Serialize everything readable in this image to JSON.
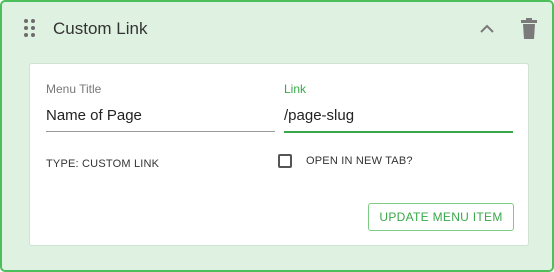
{
  "colors": {
    "accent": "#3aa84a",
    "panel_background": "#dff2e1",
    "panel_border": "#4cbf5a"
  },
  "header": {
    "title": "Custom Link",
    "drag_icon": "drag-handle-icon",
    "collapse_icon": "chevron-up-icon",
    "delete_icon": "trash-icon"
  },
  "form": {
    "menu_title": {
      "label": "Menu Title",
      "value": "Name of Page"
    },
    "link": {
      "label": "Link",
      "value": "/page-slug"
    },
    "type_label": "TYPE: CUSTOM LINK",
    "new_tab": {
      "label": "OPEN IN NEW TAB?",
      "checked": false
    },
    "update_button": "UPDATE MENU ITEM"
  }
}
